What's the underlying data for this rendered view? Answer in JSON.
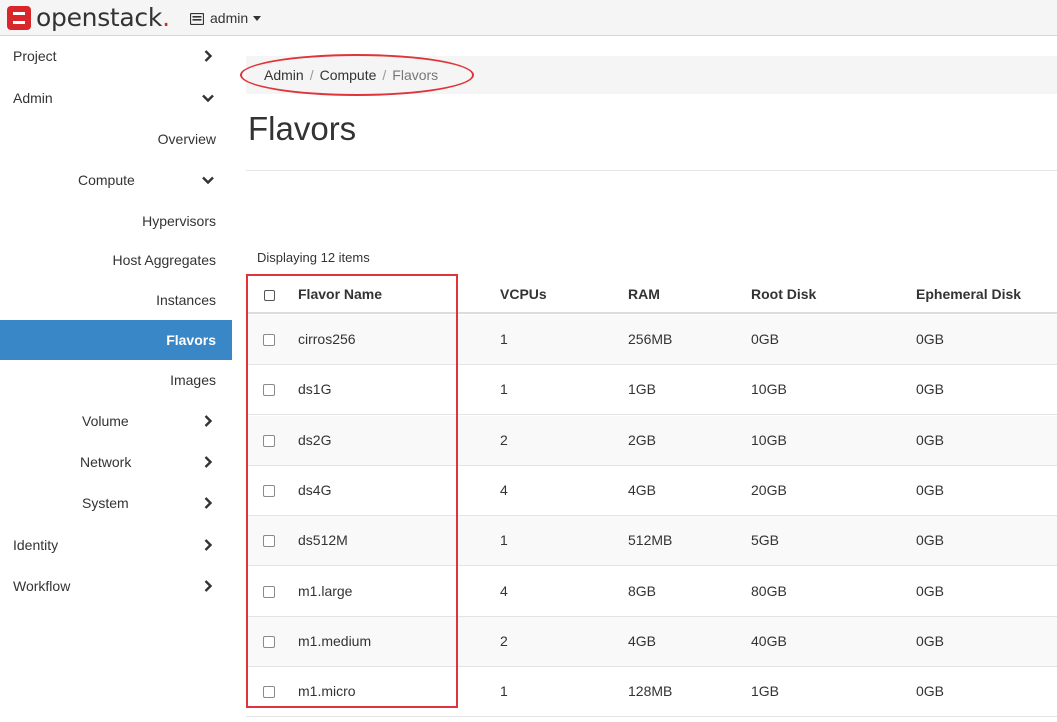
{
  "brand": {
    "name": "openstack",
    "dot": "."
  },
  "header": {
    "project_label": "admin",
    "project_icon": "server-icon"
  },
  "colors": {
    "accent": "#3a87c8",
    "brand_red": "#d9262b",
    "annotation_red": "#e0343a"
  },
  "sidebar": {
    "items": [
      {
        "label": "Project",
        "chevron": "right"
      },
      {
        "label": "Admin",
        "chevron": "down"
      },
      {
        "label": "Overview"
      },
      {
        "label": "Compute",
        "chevron": "down"
      },
      {
        "label": "Hypervisors"
      },
      {
        "label": "Host Aggregates"
      },
      {
        "label": "Instances"
      },
      {
        "label": "Flavors",
        "active": true
      },
      {
        "label": "Images"
      },
      {
        "label": "Volume",
        "chevron": "right"
      },
      {
        "label": "Network",
        "chevron": "right"
      },
      {
        "label": "System",
        "chevron": "right"
      },
      {
        "label": "Identity",
        "chevron": "right"
      },
      {
        "label": "Workflow",
        "chevron": "right"
      }
    ]
  },
  "breadcrumb": {
    "items": [
      "Admin",
      "Compute",
      "Flavors"
    ],
    "separator": "/"
  },
  "page": {
    "title": "Flavors",
    "displaying": "Displaying 12 items"
  },
  "table": {
    "columns": [
      "Flavor Name",
      "VCPUs",
      "RAM",
      "Root Disk",
      "Ephemeral Disk"
    ],
    "rows": [
      [
        "cirros256",
        "1",
        "256MB",
        "0GB",
        "0GB"
      ],
      [
        "ds1G",
        "1",
        "1GB",
        "10GB",
        "0GB"
      ],
      [
        "ds2G",
        "2",
        "2GB",
        "10GB",
        "0GB"
      ],
      [
        "ds4G",
        "4",
        "4GB",
        "20GB",
        "0GB"
      ],
      [
        "ds512M",
        "1",
        "512MB",
        "5GB",
        "0GB"
      ],
      [
        "m1.large",
        "4",
        "8GB",
        "80GB",
        "0GB"
      ],
      [
        "m1.medium",
        "2",
        "4GB",
        "40GB",
        "0GB"
      ],
      [
        "m1.micro",
        "1",
        "128MB",
        "1GB",
        "0GB"
      ]
    ]
  }
}
